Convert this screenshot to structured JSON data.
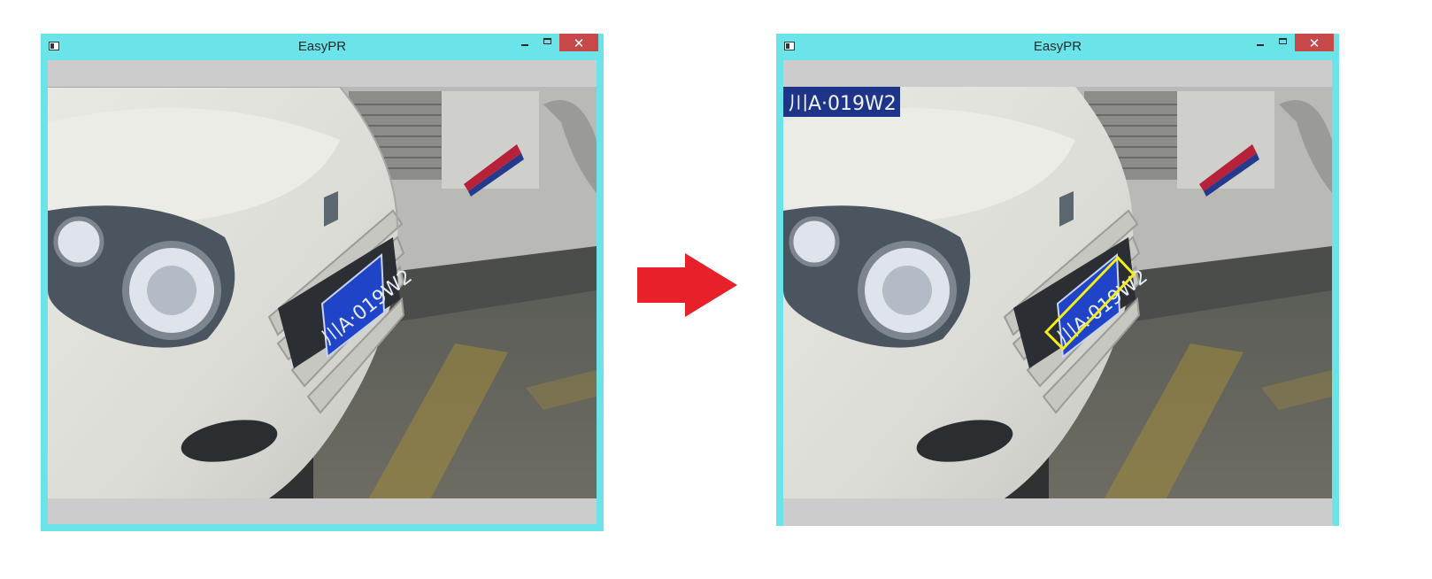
{
  "left_window": {
    "title": "EasyPR",
    "close_glyph": "✕",
    "plate_text": "川A·019W2"
  },
  "right_window": {
    "title": "EasyPR",
    "close_glyph": "✕",
    "plate_text": "川A·019W2",
    "recognized_plate_text": "川A·019W2"
  },
  "colors": {
    "window_frame": "#6ae3e9",
    "close_button": "#c74848",
    "client_background": "#cccccc",
    "arrow": "#e8202a",
    "detection_box": "#f5ef16",
    "plate_blue": "#1f44c8"
  },
  "icons": [
    "app-icon",
    "minimize-icon",
    "maximize-icon",
    "close-icon",
    "right-arrow-icon"
  ]
}
